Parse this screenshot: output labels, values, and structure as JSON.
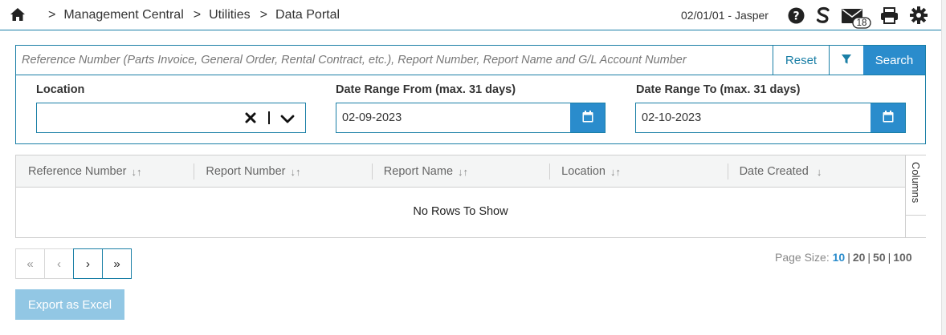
{
  "breadcrumb": {
    "items": [
      "Management Central",
      "Utilities",
      "Data Portal"
    ],
    "separator": ">"
  },
  "header": {
    "user_info": "02/01/01 - Jasper",
    "mail_count": "18",
    "icons": [
      "help-icon",
      "s-logo-icon",
      "mail-icon",
      "print-icon",
      "gear-icon"
    ]
  },
  "search": {
    "placeholder": "Reference Number (Parts Invoice, General Order, Rental Contract, etc.), Report Number, Report Name and G/L Account Number",
    "value": "",
    "reset_label": "Reset",
    "search_label": "Search"
  },
  "filters": {
    "location_label": "Location",
    "location_value": "",
    "date_from_label": "Date Range From (max. 31 days)",
    "date_from_value": "02-09-2023",
    "date_to_label": "Date Range To (max. 31 days)",
    "date_to_value": "02-10-2023"
  },
  "grid": {
    "columns": [
      {
        "label": "Reference Number",
        "sort": "↓↑"
      },
      {
        "label": "Report Number",
        "sort": "↓↑"
      },
      {
        "label": "Report Name",
        "sort": "↓↑"
      },
      {
        "label": "Location",
        "sort": "↓↑"
      },
      {
        "label": "Date Created",
        "sort": "↓"
      }
    ],
    "empty_text": "No Rows To Show",
    "columns_tab": "Columns"
  },
  "pager": {
    "first": "«",
    "prev": "‹",
    "next": "›",
    "last": "»"
  },
  "page_size": {
    "label": "Page Size:",
    "options": [
      "10",
      "20",
      "50",
      "100"
    ],
    "selected": "10"
  },
  "export_label": "Export as Excel",
  "colors": {
    "accent": "#2a8ccc",
    "border": "#1a7fa6",
    "export_disabled": "#92c7e4"
  }
}
